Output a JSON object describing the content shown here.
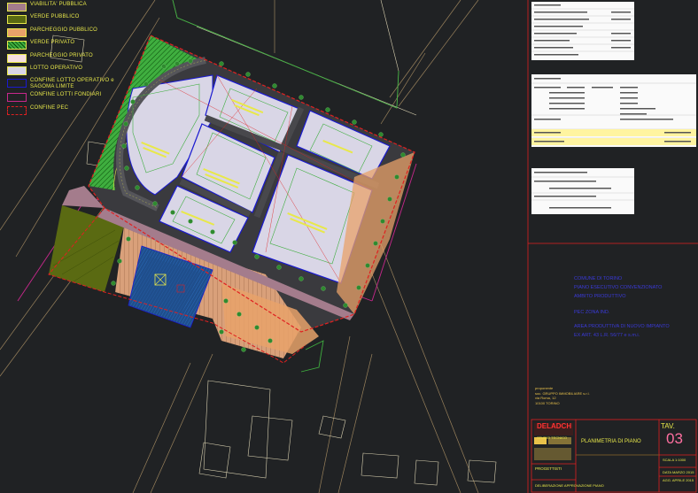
{
  "legend": [
    {
      "label": "VIABILITA' PUBBLICA",
      "color": "#a47c8c",
      "hatch": false,
      "border": "#e8e84a"
    },
    {
      "label": "VERDE PUBBLICO",
      "color": "#5a6a12",
      "hatch": false,
      "border": "#e8e84a"
    },
    {
      "label": "PARCHEGGIO PUBBLICO",
      "color": "#e8a26a",
      "hatch": false,
      "border": "#e8e84a"
    },
    {
      "label": "VERDE PRIVATO",
      "color": "#3fae3f",
      "hatch": true,
      "border": "#e8e84a"
    },
    {
      "label": "PARCHEGGIO PRIVATO",
      "color": "#f6dfe0",
      "hatch": false,
      "border": "#e8e84a"
    },
    {
      "label": "LOTTO OPERATIVO",
      "color": "#d9d6e6",
      "hatch": false,
      "border": "#e8e84a"
    },
    {
      "label": "CONFINE LOTTO OPERATIVO e SAGOMA LIMITE",
      "color": "#1a1ad0",
      "hatch": false,
      "border": "#1a1ad0"
    },
    {
      "label": "CONFINE LOTTI FONDIARI",
      "color": "#c8288c",
      "hatch": false,
      "border": "#c8288c"
    },
    {
      "label": "CONFINE PEC",
      "color": "#e02020",
      "hatch": false,
      "border": "#e02020"
    }
  ],
  "colors": {
    "background": "#202224",
    "lot": "#d9d6e6",
    "road": "#4a4a4e",
    "private_green": "#3fae3f",
    "public_green": "#5a6a12",
    "public_parking": "#e8a26a",
    "public_road": "#a47c8c",
    "lot_border": "#1a1ad0",
    "pec_border": "#e02020",
    "text_yellow": "#e8e84a"
  },
  "project": {
    "lines": [
      "COMUNE DI TORINO",
      "PIANO ESECUTIVO CONVENZIONATO",
      "AMBITO PRODUTTIVO",
      "PEC ZONA IND.",
      "AREA PRODUTTIVA DI NUOVO IMPIANTO",
      "EX ART. 43 L.R. 56/77 e s.m.i."
    ]
  },
  "proponent": {
    "lines": [
      "proponente",
      "soc. GRUPPO IMMOBILIARE s.r.l.",
      "via Roma, 12",
      "10100 TORINO"
    ]
  },
  "titleblock": {
    "logo": "DELADCH",
    "logo_sub": "STUDIO TECNICO",
    "sheet_title": "PLANIMETRIA DI PIANO",
    "tav_label": "TAV.",
    "tav_number": "03",
    "scala": "SCALA 1:1000",
    "data": "DATA MARZO 2015",
    "agg": "AGG. APRILE 2015",
    "progettisti": "PROGETTISTI",
    "deliberazione": "DELIBERAZIONE APPROVAZIONE PIANO"
  }
}
